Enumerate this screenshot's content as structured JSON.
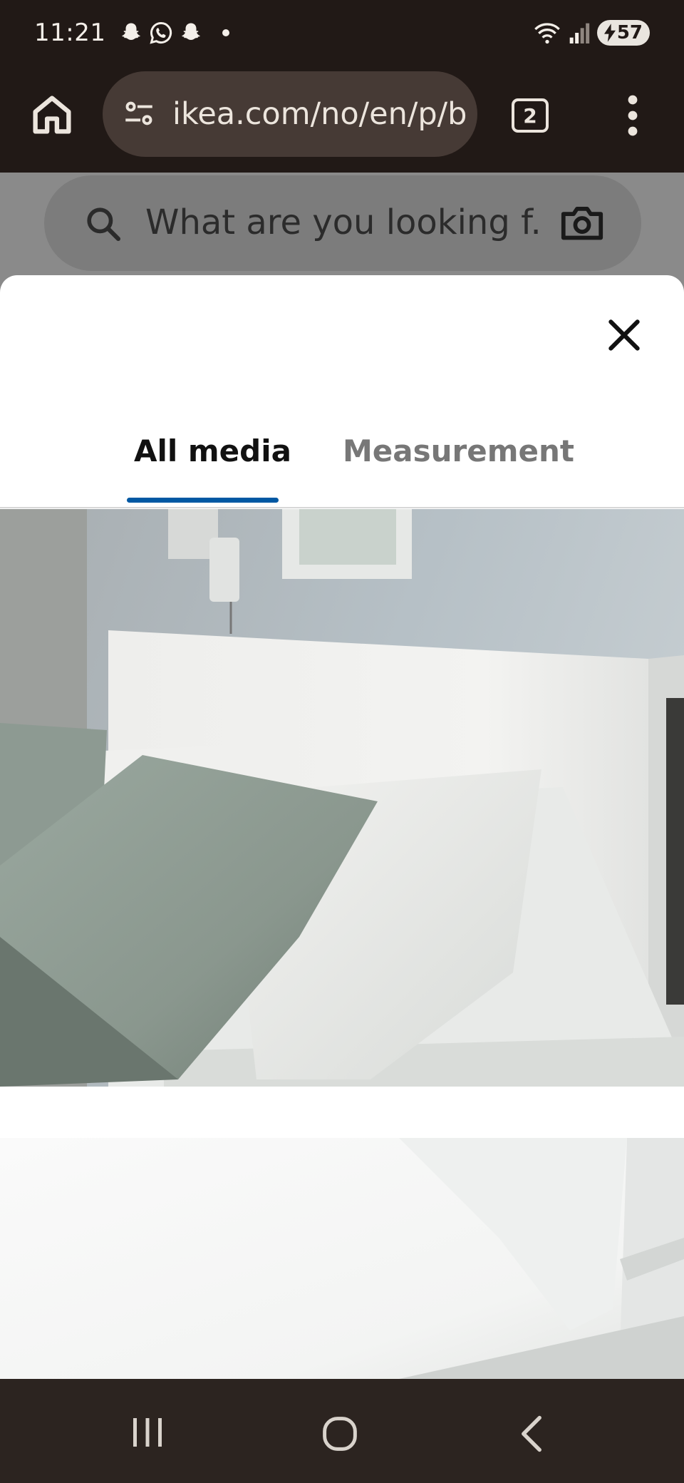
{
  "status_bar": {
    "time": "11:21",
    "notification_icons": [
      "snapchat-icon",
      "whatsapp-icon",
      "snapchat-icon"
    ],
    "battery_level": "57"
  },
  "browser": {
    "url": "ikea.com/no/en/p/b",
    "tab_count": "2"
  },
  "search": {
    "placeholder": "What are you looking f..."
  },
  "media_modal": {
    "tabs": [
      {
        "label": "All media",
        "selected": true
      },
      {
        "label": "Measurement",
        "selected": false
      }
    ],
    "accent_color": "#0058a3"
  },
  "colors": {
    "chrome_bg": "#211916",
    "url_pill_bg": "#463a35",
    "nav_bar_bg": "#2c2420"
  }
}
